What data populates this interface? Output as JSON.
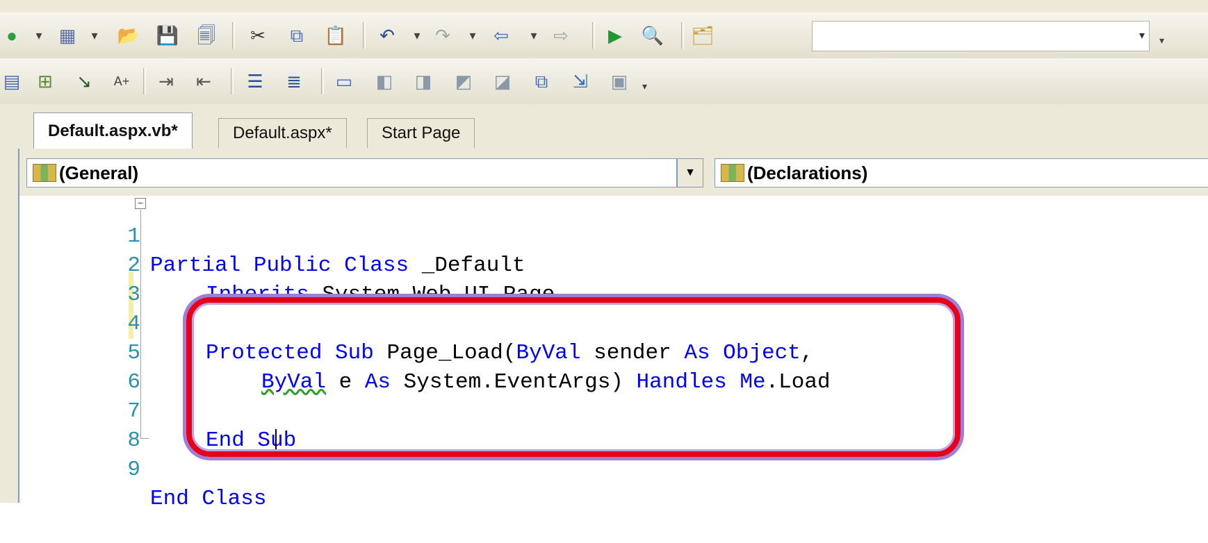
{
  "toolbar": {
    "row1": [
      "new-project-icon",
      "add-item-icon",
      "open-folder-icon",
      "save-icon",
      "save-all-icon",
      "cut-icon",
      "copy-icon",
      "paste-icon",
      "undo-icon",
      "redo-icon",
      "navigate-backward-icon",
      "navigate-forward-icon",
      "start-debugging-icon",
      "find-in-files-icon",
      "solution-explorer-icon"
    ],
    "row2": [
      "view-properties-icon",
      "design-icon",
      "tab-order-icon",
      "font-size-icon",
      "indent-icon",
      "outdent-icon",
      "comment-icon",
      "uncomment-icon",
      "bookmark-icon",
      "previous-bookmark-icon",
      "next-bookmark-icon",
      "previous-bookmark-folder-icon",
      "next-bookmark-folder-icon",
      "clear-bookmarks-icon"
    ]
  },
  "tabs": [
    {
      "label": "Default.aspx.vb*",
      "active": true
    },
    {
      "label": "Default.aspx*",
      "active": false
    },
    {
      "label": "Start Page",
      "active": false
    }
  ],
  "navigation": {
    "class_selector": "(General)",
    "member_selector": "(Declarations)"
  },
  "code_lines": [
    {
      "num": "1",
      "text": "Partial Public Class _Default"
    },
    {
      "num": "2",
      "text": "    Inherits System.Web.UI.Page"
    },
    {
      "num": "3",
      "text": ""
    },
    {
      "num": "4",
      "text": "    Protected Sub Page_Load(ByVal sender As Object,"
    },
    {
      "num": "5",
      "text": "        ByVal e As System.EventArgs) Handles Me.Load"
    },
    {
      "num": "6",
      "text": ""
    },
    {
      "num": "7",
      "text": "    End Sub"
    },
    {
      "num": "8",
      "text": ""
    },
    {
      "num": "9",
      "text": "End Class"
    }
  ],
  "highlight_color": "#e8001b",
  "keyword_color": "#0000ff",
  "line_number_color": "#2b91af"
}
